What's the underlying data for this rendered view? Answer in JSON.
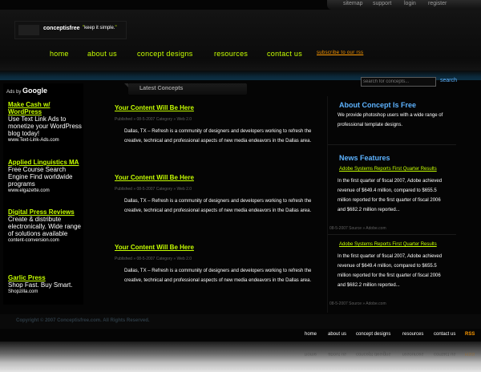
{
  "util_nav": [
    "sitemap",
    "support",
    "login",
    "register"
  ],
  "logo": {
    "name": "conceptisfree",
    "tagline": "keep it simple."
  },
  "nav": {
    "items": [
      "home",
      "about us",
      "concept designs",
      "resources",
      "contact us"
    ],
    "rss_label": "subscribe to our rss"
  },
  "search": {
    "placeholder": "search for concepts...",
    "button": "search"
  },
  "ads": {
    "by_label": "Ads by",
    "by_brand": "Google",
    "items": [
      {
        "title": "Make Cash w/ WordPress",
        "text": "Use Text Link Ads to monetize your WordPress blog today!",
        "url": "www.Text-Link-Ads.com"
      },
      {
        "title": "Applied Linguistics MA",
        "text": "Free Course Search Engine Find worldwide programs",
        "url": "www.elgazette.com"
      },
      {
        "title": "Digital Press Reviews",
        "text": "Create & distribute electronically. Wide range of solutions available",
        "url": "content-conversion.com"
      },
      {
        "title": "Garlic Press",
        "text": "Shop Fast. Buy Smart.",
        "url": "Shopzilla.com"
      }
    ]
  },
  "latest": {
    "heading": "Latest Concepts",
    "posts": [
      {
        "title": "Your Content Will Be Here",
        "meta": "Published » 08-5-2007        Category » Web 2.0",
        "body": "Dallas, TX – Refresh is a community of designers and developers working to refresh the creative, technical and professional aspects of new media endeavors in the Dallas area."
      },
      {
        "title": "Your Content Will Be Here",
        "meta": "Published » 08-5-2007        Category » Web 2.0",
        "body": "Dallas, TX – Refresh is a community of designers and developers working to refresh the creative, technical and professional aspects of new media endeavors in the Dallas area."
      },
      {
        "title": "Your Content Will Be Here",
        "meta": "Published » 08-5-2007        Category » Web 2.0",
        "body": "Dallas, TX – Refresh is a community of designers and developers working to refresh the creative, technical and professional aspects of new media endeavors in the Dallas area."
      }
    ]
  },
  "about": {
    "title": "About Concept Is Free",
    "text": "We provide photoshop users with a wide range of professional template designs."
  },
  "news": {
    "title": "News Features",
    "items": [
      {
        "link": "Adobe Systems Reports First Quarter Results",
        "body": "In the first quarter of fiscal 2007, Adobe achieved revenue of $649.4 million, compared to $655.5 million reported for the first quarter of fiscal 2006 and $682.2 million reported...",
        "date": "08-5-2007      Source » Adobe.com"
      },
      {
        "link": "Adobe Systems Reports First Quarter Results",
        "body": "In the first quarter of fiscal 2007, Adobe achieved revenue of $649.4 million, compared to $655.5 million reported for the first quarter of fiscal 2006 and $682.2 million reported...",
        "date": "08-5-2007      Source » Adobe.com"
      }
    ]
  },
  "footer": {
    "copyright": "Copyright © 2007 Conceptisfree.com. All Rights Reserved.",
    "nav": [
      "home",
      "about us",
      "concept designs",
      "resources",
      "contact us"
    ],
    "rss": "RSS"
  },
  "colors": {
    "accent": "#c6ff00",
    "blue": "#5db3ff",
    "rss": "#ff9a00",
    "bg": "#050505"
  }
}
